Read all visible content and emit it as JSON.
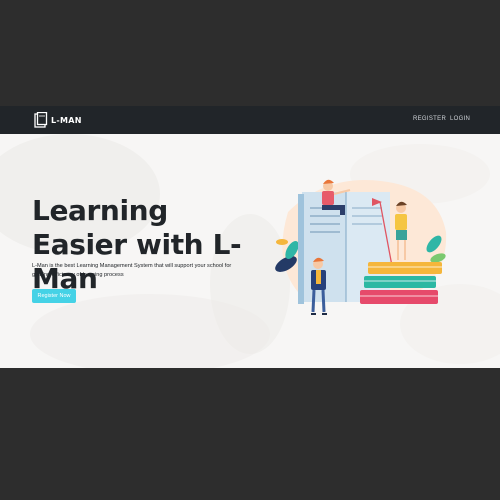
{
  "navbar": {
    "brand": "L-MAN",
    "links": [
      "REGISTER",
      "LOGIN"
    ]
  },
  "hero": {
    "title": "Learning Easier with L-Man",
    "subtitle": "L-Man is the best Learning Management System that will support your school for gaining efficiency of learning process",
    "cta_label": "Register Now"
  },
  "icons": {
    "brand": "open-book-logo-icon",
    "illustration": "students-with-books-illustration"
  },
  "colors": {
    "navbar": "#212529",
    "page_frame": "#2d2d2d",
    "cta": "#45d2e6",
    "title": "#212529"
  }
}
